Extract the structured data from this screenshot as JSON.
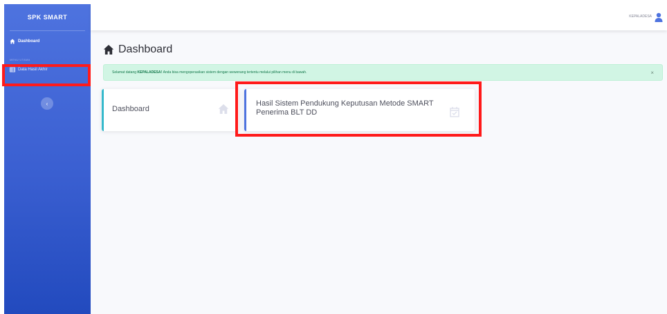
{
  "sidebar": {
    "brand": "SPK SMART",
    "dashboard_label": "Dashboard",
    "heading": "MENU UTAMA",
    "hasil_label": "Data Hasil Akhir",
    "toggle_symbol": "‹"
  },
  "topbar": {
    "username": "KEPALADESA"
  },
  "main": {
    "title": "Dashboard",
    "alert": {
      "prefix": "Selamat datang",
      "role": "KEPALADESA!",
      "suffix": "Anda bisa mengoperasikan sistem dengan wewenang tertentu melalui pilihan menu di bawah.",
      "close": "×"
    },
    "cards": [
      {
        "label": "Dashboard",
        "icon": "home-icon"
      },
      {
        "label": "Hasil Sistem Pendukung Keputusan Metode SMART Penerima BLT DD",
        "icon": "calendar-check-icon"
      }
    ]
  },
  "colors": {
    "sidebar_top": "#4e73df",
    "sidebar_bottom": "#224abe",
    "alert_bg": "#d1f5e4",
    "alert_text": "#14794c",
    "card_left_border": "#36b9cc",
    "card_right_border": "#4e73df",
    "highlight": "#ff1a1a"
  }
}
